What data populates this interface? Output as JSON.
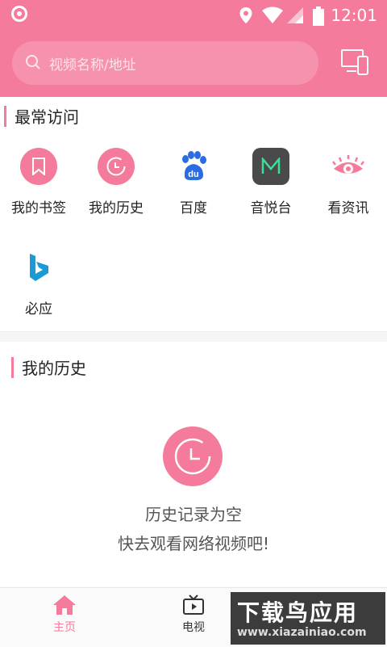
{
  "status_bar": {
    "time": "12:01"
  },
  "search": {
    "placeholder": "视频名称/地址"
  },
  "frequent": {
    "title": "最常访问",
    "items": [
      {
        "label": "我的书签",
        "icon": "bookmark-icon"
      },
      {
        "label": "我的历史",
        "icon": "history-icon"
      },
      {
        "label": "百度",
        "icon": "baidu-icon"
      },
      {
        "label": "音悦台",
        "icon": "yinyuetai-icon"
      },
      {
        "label": "看资讯",
        "icon": "eye-icon"
      },
      {
        "label": "必应",
        "icon": "bing-icon"
      }
    ]
  },
  "history": {
    "title": "我的历史",
    "empty_line1": "历史记录为空",
    "empty_line2": "快去观看网络视频吧!"
  },
  "bottom_nav": {
    "items": [
      {
        "label": "主页",
        "active": true
      },
      {
        "label": "电视",
        "active": false
      }
    ]
  },
  "watermark": {
    "title": "下载鸟应用",
    "site": "www.xiazainiao.com"
  },
  "colors": {
    "accent": "#f47b9b",
    "baidu_blue": "#2b6de0",
    "yinyuetai_green": "#3ddc97",
    "bing_blue": "#1a9ad6"
  }
}
